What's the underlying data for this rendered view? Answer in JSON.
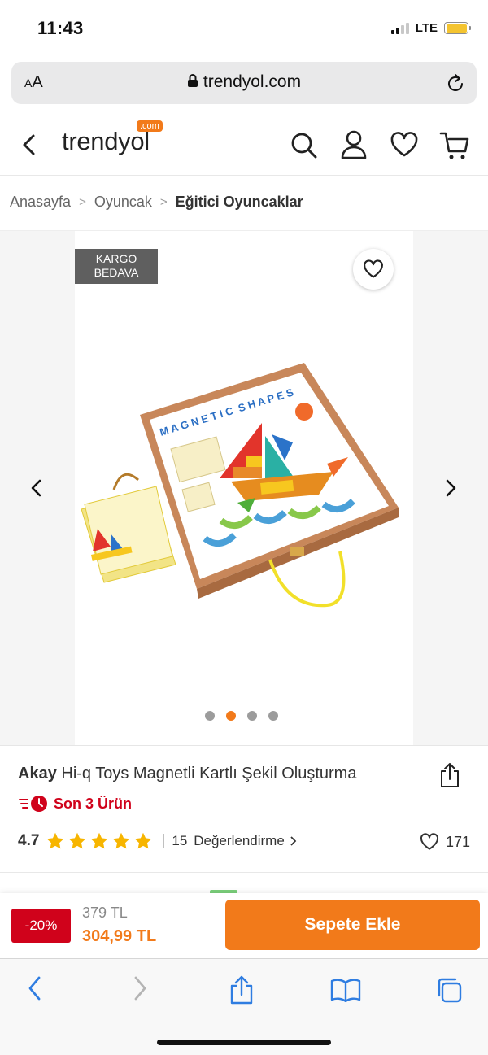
{
  "status": {
    "time": "11:43",
    "network": "LTE"
  },
  "browser": {
    "text_size_label": "AA",
    "url": "trendyol.com"
  },
  "header": {
    "logo": "trendyol",
    "logo_badge": ".com"
  },
  "breadcrumb": [
    "Anasayfa",
    "Oyuncak",
    "Eğitici Oyuncaklar"
  ],
  "gallery": {
    "badge_line1": "KARGO",
    "badge_line2": "BEDAVA",
    "image_count": 4,
    "active_index": 1,
    "box_title": "MAGNETIC SHAPES"
  },
  "product": {
    "brand": "Akay",
    "name": "Hi-q Toys Magnetli Kartlı Şekil Oluşturma",
    "stock_notice": "Son 3 Ürün",
    "rating": "4.7",
    "stars": 5,
    "review_count": "15",
    "review_label": "Değerlendirme",
    "favorite_count": "171"
  },
  "pricing": {
    "discount": "-20%",
    "old_price": "379 TL",
    "new_price": "304,99 TL",
    "cta": "Sepete Ekle"
  },
  "colors": {
    "brand": "#f27a1a",
    "discount": "#d0021b",
    "safari_blue": "#2f7de1"
  }
}
